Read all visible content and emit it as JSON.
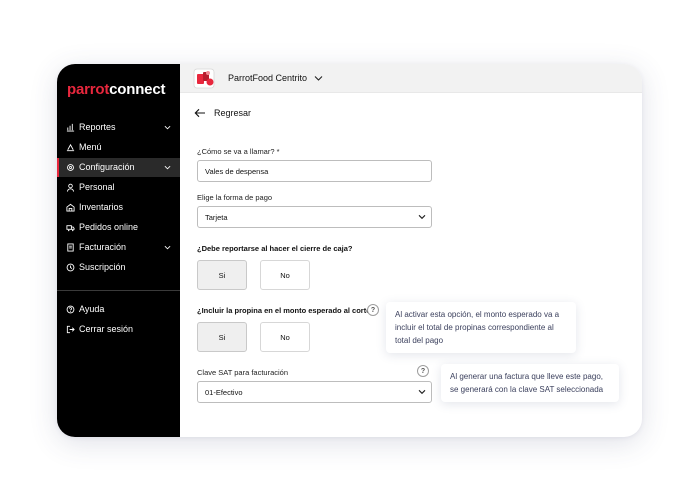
{
  "brand": {
    "logo_part1": "parrot",
    "logo_part2": "connect"
  },
  "sidebar": {
    "items": [
      {
        "label": "Reportes",
        "icon": "chart-icon",
        "has_chevron": true
      },
      {
        "label": "Menú",
        "icon": "tray-icon",
        "has_chevron": false
      },
      {
        "label": "Configuración",
        "icon": "gear-icon",
        "has_chevron": true,
        "active": true
      },
      {
        "label": "Personal",
        "icon": "user-icon",
        "has_chevron": false
      },
      {
        "label": "Inventarios",
        "icon": "warehouse-icon",
        "has_chevron": false
      },
      {
        "label": "Pedidos online",
        "icon": "delivery-icon",
        "has_chevron": false
      },
      {
        "label": "Facturación",
        "icon": "invoice-icon",
        "has_chevron": true
      },
      {
        "label": "Suscripción",
        "icon": "subscription-icon",
        "has_chevron": false
      }
    ],
    "bottom_items": [
      {
        "label": "Ayuda",
        "icon": "help-icon"
      },
      {
        "label": "Cerrar sesión",
        "icon": "logout-icon"
      }
    ]
  },
  "header": {
    "store_name": "ParrotFood Centrito"
  },
  "back_label": "Regresar",
  "form": {
    "name_label": "¿Cómo se va a llamar? *",
    "name_value": "Vales de despensa",
    "payment_label": "Elige la forma de pago",
    "payment_value": "Tarjeta",
    "report_question": "¿Debe reportarse al hacer el cierre de caja?",
    "report_yes": "Si",
    "report_no": "No",
    "tip_question": "¿Incluir la propina en el monto esperado al corte?",
    "tip_yes": "Si",
    "tip_no": "No",
    "sat_label": "Clave SAT para facturación",
    "sat_value": "01-Efectivo",
    "help_mark": "?"
  },
  "tooltips": {
    "tip_line1": "Al activar esta opción, el monto esperado va a",
    "tip_line2": "incluir el total de propinas correspondiente al",
    "tip_line3": "total del pago",
    "sat_line1": "Al generar una factura que lleve este pago,",
    "sat_line2": "se generará con la clave SAT seleccionada"
  },
  "colors": {
    "accent": "#e8273d",
    "sidebar_bg": "#000000",
    "topbar_bg": "#f2f2f2",
    "tooltip_text": "#3a3f5c"
  }
}
